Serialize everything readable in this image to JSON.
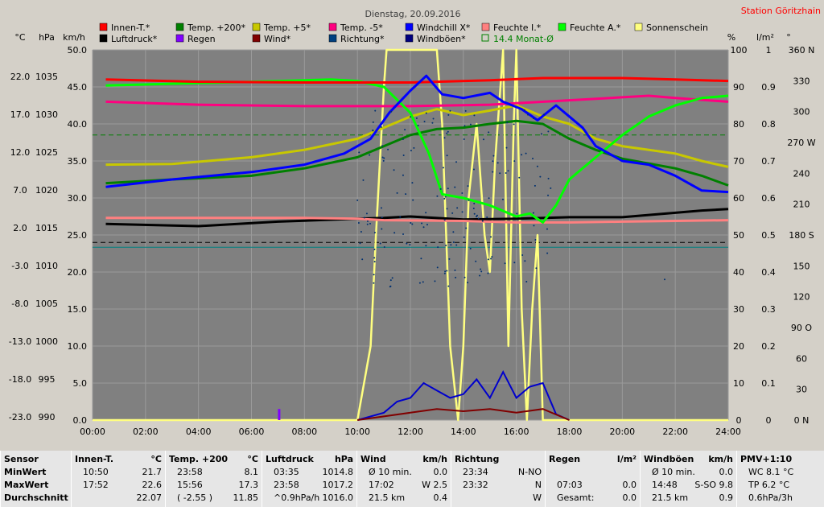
{
  "header": {
    "title": "Dienstag, 20.09.2016",
    "station": "Station Göritzhain"
  },
  "units": {
    "celsius": "°C",
    "hpa": "hPa",
    "kmh": "km/h",
    "percent": "%",
    "lm2": "l/m²",
    "degree": "°"
  },
  "legend": [
    {
      "label": "Innen-T.*",
      "color": "#ff0000"
    },
    {
      "label": "Temp. +200*",
      "color": "#008000"
    },
    {
      "label": "Temp. +5*",
      "color": "#c8c800"
    },
    {
      "label": "Temp. -5*",
      "color": "#ff0080"
    },
    {
      "label": "Windchill X*",
      "color": "#0000ff"
    },
    {
      "label": "Feuchte I.*",
      "color": "#ff8080"
    },
    {
      "label": "Feuchte A.*",
      "color": "#00ff00"
    },
    {
      "label": "Sonnenschein",
      "color": "#ffff80"
    },
    {
      "label": "Luftdruck*",
      "color": "#000000"
    },
    {
      "label": "Regen",
      "color": "#8000ff"
    },
    {
      "label": "Wind*",
      "color": "#800000"
    },
    {
      "label": "Richtung*",
      "color": "#004080"
    },
    {
      "label": "Windböen*",
      "color": "#000080"
    },
    {
      "label": "14.4 Monat-Ø",
      "color": "#008000"
    }
  ],
  "chart_data": {
    "type": "line",
    "x_ticks": [
      "00:00",
      "02:00",
      "04:00",
      "06:00",
      "08:00",
      "10:00",
      "12:00",
      "14:00",
      "16:00",
      "18:00",
      "20:00",
      "22:00",
      "24:00"
    ],
    "axes": {
      "celsius": [
        "22.0",
        "17.0",
        "12.0",
        "7.0",
        "2.0",
        "-3.0",
        "-8.0",
        "-13.0",
        "-18.0",
        "-23.0"
      ],
      "hpa": [
        "1035",
        "1030",
        "1025",
        "1020",
        "1015",
        "1010",
        "1005",
        "1000",
        "995",
        "990"
      ],
      "kmh": [
        "50.0",
        "45.0",
        "40.0",
        "35.0",
        "30.0",
        "25.0",
        "20.0",
        "15.0",
        "10.0",
        "5.0",
        "0.0"
      ],
      "percent": [
        "100",
        "90",
        "80",
        "70",
        "60",
        "50",
        "40",
        "30",
        "20",
        "10",
        "0"
      ],
      "lm2": [
        "1",
        "0.9",
        "0.8",
        "0.7",
        "0.6",
        "0.5",
        "0.4",
        "0.3",
        "0.2",
        "0.1",
        "0"
      ],
      "direction": [
        "360 N",
        "330",
        "300",
        "270 W",
        "240",
        "210",
        "180 S",
        "150",
        "120",
        "90 O",
        "60",
        "30",
        "0 N"
      ]
    },
    "x_range_h": [
      0,
      24
    ],
    "kmh_range": [
      0,
      50
    ],
    "grid": true,
    "series": [
      {
        "name": "Innen-T.*",
        "color": "#ff0000",
        "kmh_scale": true,
        "points": [
          [
            0.5,
            46
          ],
          [
            4,
            45.7
          ],
          [
            8,
            45.6
          ],
          [
            12,
            45.6
          ],
          [
            15,
            45.9
          ],
          [
            17,
            46.2
          ],
          [
            20,
            46.2
          ],
          [
            22,
            46
          ],
          [
            24,
            45.8
          ]
        ]
      },
      {
        "name": "Temp. +200*",
        "color": "#008000",
        "kmh_scale": true,
        "points": [
          [
            0.5,
            32
          ],
          [
            3,
            32.5
          ],
          [
            6,
            33
          ],
          [
            8,
            34
          ],
          [
            10,
            35.5
          ],
          [
            11,
            37
          ],
          [
            12,
            38.5
          ],
          [
            13,
            39.3
          ],
          [
            14,
            39.5
          ],
          [
            15,
            40
          ],
          [
            16,
            40.4
          ],
          [
            17,
            40
          ],
          [
            18,
            38
          ],
          [
            19,
            36.5
          ],
          [
            20,
            35.3
          ],
          [
            22,
            34
          ],
          [
            23,
            33
          ],
          [
            24,
            31.7
          ]
        ]
      },
      {
        "name": "Temp. +5*",
        "color": "#c8c800",
        "kmh_scale": true,
        "points": [
          [
            0.5,
            34.5
          ],
          [
            3,
            34.6
          ],
          [
            6,
            35.5
          ],
          [
            8,
            36.5
          ],
          [
            10,
            38
          ],
          [
            11,
            39.5
          ],
          [
            12,
            41
          ],
          [
            13,
            42
          ],
          [
            14,
            41.2
          ],
          [
            15,
            41.8
          ],
          [
            16,
            42.5
          ],
          [
            17,
            41
          ],
          [
            18,
            40
          ],
          [
            19,
            38
          ],
          [
            20,
            37
          ],
          [
            22,
            36
          ],
          [
            23,
            35
          ],
          [
            24,
            34.2
          ]
        ]
      },
      {
        "name": "Temp. -5*",
        "color": "#ff0080",
        "kmh_scale": true,
        "points": [
          [
            0.5,
            43
          ],
          [
            4,
            42.6
          ],
          [
            8,
            42.4
          ],
          [
            12,
            42.4
          ],
          [
            15,
            42.6
          ],
          [
            18,
            43.2
          ],
          [
            21,
            43.8
          ],
          [
            22,
            43.5
          ],
          [
            24,
            43
          ]
        ]
      },
      {
        "name": "Windchill X*",
        "color": "#0000ff",
        "kmh_scale": true,
        "points": [
          [
            0.5,
            31.5
          ],
          [
            3,
            32.5
          ],
          [
            6,
            33.5
          ],
          [
            8,
            34.5
          ],
          [
            9.5,
            36
          ],
          [
            10.5,
            38
          ],
          [
            11.2,
            41.5
          ],
          [
            12,
            44.5
          ],
          [
            12.6,
            46.5
          ],
          [
            13.2,
            44
          ],
          [
            14,
            43.5
          ],
          [
            15,
            44.2
          ],
          [
            15.5,
            43
          ],
          [
            16.2,
            42
          ],
          [
            16.8,
            40.5
          ],
          [
            17.5,
            42.5
          ],
          [
            18,
            41
          ],
          [
            18.5,
            39.5
          ],
          [
            19,
            37
          ],
          [
            20,
            35
          ],
          [
            21,
            34.5
          ],
          [
            22,
            33
          ],
          [
            23,
            31
          ],
          [
            24,
            30.8
          ]
        ]
      },
      {
        "name": "Feuchte I.*",
        "color": "#ff8080",
        "kmh_scale": true,
        "points": [
          [
            0.5,
            27.3
          ],
          [
            4,
            27.3
          ],
          [
            8,
            27.3
          ],
          [
            10,
            27.2
          ],
          [
            11,
            27
          ],
          [
            14,
            26.9
          ],
          [
            16,
            26.7
          ],
          [
            18,
            26.7
          ],
          [
            20,
            26.8
          ],
          [
            22,
            26.9
          ],
          [
            24,
            27
          ]
        ]
      },
      {
        "name": "Feuchte A.*",
        "color": "#00ff00",
        "kmh_scale": true,
        "points": [
          [
            0.5,
            45.2
          ],
          [
            6,
            45.7
          ],
          [
            9,
            46
          ],
          [
            10,
            45.8
          ],
          [
            11,
            45
          ],
          [
            12,
            41.5
          ],
          [
            12.7,
            36
          ],
          [
            13.2,
            30.5
          ],
          [
            14,
            30
          ],
          [
            15,
            29
          ],
          [
            16,
            27.5
          ],
          [
            16.5,
            27.9
          ],
          [
            17,
            26.7
          ],
          [
            17.5,
            29
          ],
          [
            18,
            32.5
          ],
          [
            19,
            35.5
          ],
          [
            20,
            38.5
          ],
          [
            21,
            41
          ],
          [
            22,
            42.5
          ],
          [
            23,
            43.5
          ],
          [
            24,
            43.8
          ]
        ]
      },
      {
        "name": "Sonnenschein",
        "color": "#ffff80",
        "kmh_scale": true,
        "points": [
          [
            0,
            0
          ],
          [
            10,
            0
          ],
          [
            10.5,
            10
          ],
          [
            10.7,
            25
          ],
          [
            11,
            45
          ],
          [
            11.1,
            50
          ],
          [
            13.0,
            50
          ],
          [
            13.2,
            40
          ],
          [
            13.5,
            10
          ],
          [
            13.8,
            0
          ],
          [
            14,
            10
          ],
          [
            14.2,
            30
          ],
          [
            14.5,
            40
          ],
          [
            14.8,
            25
          ],
          [
            15,
            20
          ],
          [
            15.2,
            35
          ],
          [
            15.5,
            50
          ],
          [
            15.7,
            10
          ],
          [
            15.9,
            40
          ],
          [
            16.0,
            50
          ],
          [
            16.2,
            15
          ],
          [
            16.4,
            0
          ],
          [
            16.6,
            15
          ],
          [
            16.8,
            25
          ],
          [
            17,
            0
          ],
          [
            24,
            0
          ]
        ]
      },
      {
        "name": "Luftdruck*",
        "color": "#000000",
        "kmh_scale": true,
        "points": [
          [
            0.5,
            26.5
          ],
          [
            4,
            26.2
          ],
          [
            7,
            26.8
          ],
          [
            10,
            27.2
          ],
          [
            11,
            27.3
          ],
          [
            12,
            27.5
          ],
          [
            14,
            27.1
          ],
          [
            16,
            27.2
          ],
          [
            18,
            27.4
          ],
          [
            20,
            27.4
          ],
          [
            22,
            28
          ],
          [
            23,
            28.3
          ],
          [
            24,
            28.5
          ]
        ]
      }
    ],
    "wind": [
      [
        10,
        0
      ],
      [
        11,
        1
      ],
      [
        11.5,
        2.5
      ],
      [
        12,
        3
      ],
      [
        12.5,
        5
      ],
      [
        13,
        4
      ],
      [
        13.5,
        3
      ],
      [
        14,
        3.5
      ],
      [
        14.5,
        5.5
      ],
      [
        15,
        3
      ],
      [
        15.5,
        6.5
      ],
      [
        16,
        3
      ],
      [
        16.5,
        4.5
      ],
      [
        17,
        5
      ],
      [
        17.5,
        0.8
      ],
      [
        18,
        0
      ]
    ],
    "wind_avg": [
      [
        10,
        0
      ],
      [
        11,
        0.5
      ],
      [
        12,
        1
      ],
      [
        13,
        1.5
      ],
      [
        14,
        1.2
      ],
      [
        15,
        1.5
      ],
      [
        16,
        1
      ],
      [
        17,
        1.5
      ],
      [
        18,
        0
      ]
    ],
    "rain": [
      {
        "x": 7.03,
        "v": 0.0
      }
    ],
    "month_avg_line_kmh": 38.5,
    "avg_dashed_kmh": 24
  },
  "stats": {
    "columns": [
      {
        "title": "Sensor",
        "unit": "",
        "rows": [
          [
            "MinWert",
            "",
            ""
          ],
          [
            "MaxWert",
            "",
            ""
          ],
          [
            "Durchschnitt",
            "",
            ""
          ]
        ]
      },
      {
        "title": "Innen-T.",
        "unit": "°C",
        "rows": [
          [
            "10:50",
            "21.7"
          ],
          [
            "17:52",
            "22.6"
          ],
          [
            "",
            "22.07"
          ]
        ]
      },
      {
        "title": "Temp. +200",
        "unit": "°C",
        "rows": [
          [
            "23:58",
            "8.1"
          ],
          [
            "15:56",
            "17.3"
          ],
          [
            "( -2.55 )",
            "11.85"
          ]
        ]
      },
      {
        "title": "Luftdruck",
        "unit": "hPa",
        "rows": [
          [
            "03:35",
            "1014.8"
          ],
          [
            "23:58",
            "1017.2"
          ],
          [
            "^0.9hPa/h",
            "1016.0"
          ]
        ]
      },
      {
        "title": "Wind",
        "unit": "km/h",
        "rows": [
          [
            "Ø 10 min.",
            "0.0"
          ],
          [
            "17:02",
            "W 2.5"
          ],
          [
            "21.5 km",
            "0.4"
          ]
        ]
      },
      {
        "title": "Richtung",
        "unit": "",
        "rows": [
          [
            "23:34",
            "N-NO"
          ],
          [
            "23:32",
            "N"
          ],
          [
            "",
            "W"
          ]
        ]
      },
      {
        "title": "Regen",
        "unit": "l/m²",
        "rows": [
          [
            "",
            ""
          ],
          [
            "07:03",
            "0.0"
          ],
          [
            "Gesamt:",
            "0.0"
          ]
        ]
      },
      {
        "title": "Windböen",
        "unit": "km/h",
        "rows": [
          [
            "Ø 10 min.",
            "0.0"
          ],
          [
            "14:48",
            "S-SO 9.8"
          ],
          [
            "21.5 km",
            "0.9"
          ]
        ]
      },
      {
        "title": "PMV+1:10",
        "unit": "",
        "rows": [
          [
            "WC 8.1 °C",
            ""
          ],
          [
            "TP 6.2 °C",
            ""
          ],
          [
            "0.6hPa/3h",
            ""
          ]
        ]
      }
    ]
  }
}
